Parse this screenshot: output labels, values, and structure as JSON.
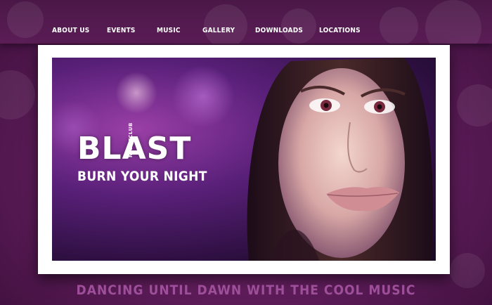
{
  "nav": {
    "items": [
      {
        "label": "ABOUT US"
      },
      {
        "label": "EVENTS"
      },
      {
        "label": "MUSIC"
      },
      {
        "label": "GALLERY"
      },
      {
        "label": "DOWNLOADS"
      },
      {
        "label": "LOCATIONS"
      }
    ]
  },
  "hero": {
    "brand_name": "BLAST",
    "brand_sub": "NIGHTCLUB",
    "tagline": "BURN YOUR NIGHT"
  },
  "footer_slogan": "DANCING UNTIL DAWN WITH THE COOL MUSIC",
  "colors": {
    "background": "#641f5f",
    "nav_bar": "#4f1a4b",
    "frame": "#ffffff",
    "slogan": "#9d4f99"
  }
}
